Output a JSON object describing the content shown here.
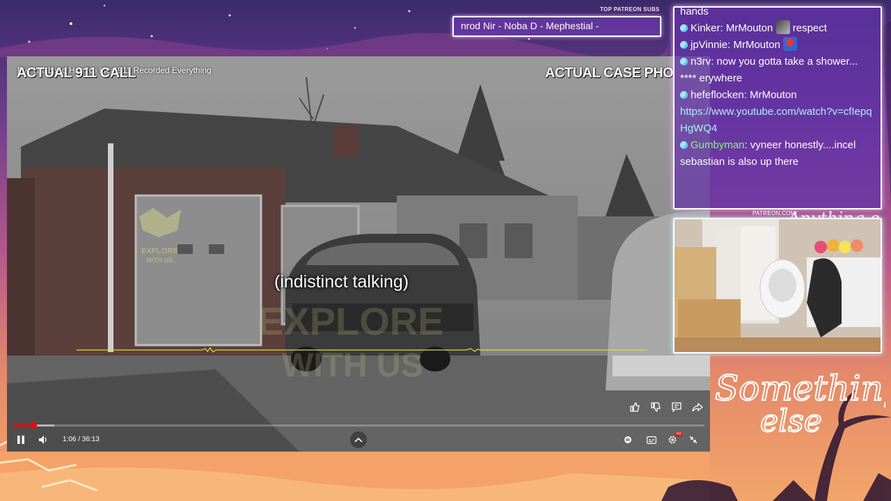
{
  "patreon": {
    "label": "TOP PATREON SUBS",
    "ticker": "nrod Nir - Noba D - Mephestial -",
    "url_label": "PATREON.COM/"
  },
  "player": {
    "video_title": "Evil Husband Has No Idea 911 Recorded Everything",
    "overlay_left": "ACTUAL 911 CALL",
    "overlay_right": "ACTUAL CASE PHO",
    "caption": "(indistinct talking)",
    "watermark_small": "EXPLORE WITH US.",
    "watermark_big": "EXPLORE WITH US",
    "time_display": "1:06 / 36:13",
    "progress": {
      "played_fraction": 0.03,
      "buffered_fraction": 0.06
    },
    "settings_badge": "HD"
  },
  "chat": {
    "messages": [
      {
        "user": "",
        "text": "hands",
        "bullet": false
      },
      {
        "user": "Kinker",
        "text": "MrMouton",
        "after": "respect",
        "emote": "ghost-emote",
        "bullet": true
      },
      {
        "user": "jpVinnie",
        "text": "MrMouton",
        "emote": "mario-emote",
        "bullet": true
      },
      {
        "user": "n3rv",
        "text": "now you gotta take a shower... **** erywhere",
        "bullet": true
      },
      {
        "user": "hefeflocken",
        "text": "MrMouton",
        "link": "https://www.youtube.com/watch?v=cfIepqHgWQ4",
        "bullet": true
      },
      {
        "user": "Gumbyman",
        "user_color": "#7dff6b",
        "text": "vyneer honestly....incel sebastian is also up there",
        "bullet": true
      }
    ]
  },
  "branding": {
    "small_logo": "Anything else?",
    "big_logo": "Something else"
  },
  "colors": {
    "chat_bg": "#6432aa",
    "progress_red": "#ff0000",
    "link_color": "#aef0ff",
    "username_green": "#7dff6b"
  }
}
